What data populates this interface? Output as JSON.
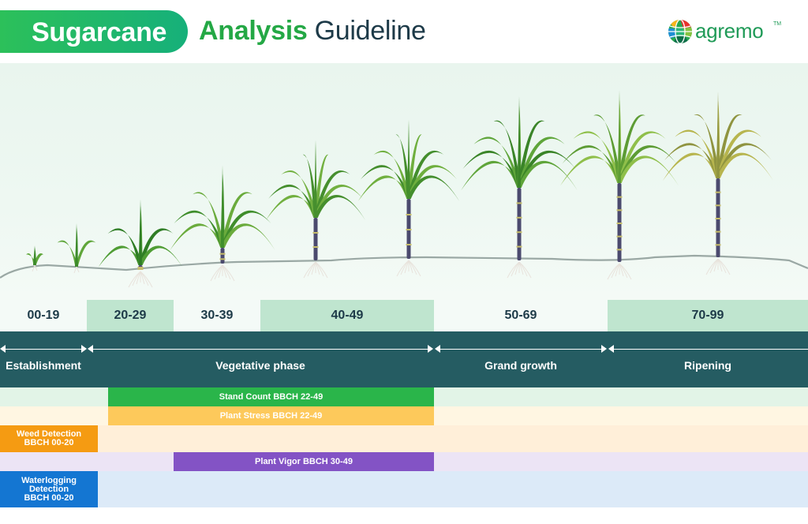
{
  "header": {
    "title_pill": "Sugarcane",
    "title_bold": "Analysis",
    "title_rest": "Guideline"
  },
  "logo": {
    "text": "agremo",
    "tm": "TM",
    "icon": "globe-icon"
  },
  "scene": {
    "description_icon": "sugarcane-growth-stages-illustration"
  },
  "bbch_ranges": [
    {
      "label": "00-19",
      "bg": "#f4faf7"
    },
    {
      "label": "20-29",
      "bg": "#bfe5cf"
    },
    {
      "label": "30-39",
      "bg": "#f4faf7"
    },
    {
      "label": "40-49",
      "bg": "#bfe5cf"
    },
    {
      "label": "50-69",
      "bg": "#f4faf7"
    },
    {
      "label": "70-99",
      "bg": "#bfe5cf"
    }
  ],
  "phases": [
    {
      "label": "Establishment"
    },
    {
      "label": "Vegetative phase"
    },
    {
      "label": "Grand growth"
    },
    {
      "label": "Ripening"
    }
  ],
  "colors": {
    "phase_band": "#255c62",
    "stand_count": "#2ab54a",
    "plant_stress": "#fdc95b",
    "weed_detection": "#f59b12",
    "plant_vigor": "#8353c5",
    "waterlogging": "#1476d2"
  },
  "analyses": {
    "stand_count": "Stand Count BBCH 22-49",
    "plant_stress": "Plant Stress BBCH 22-49",
    "weed_detection": [
      "Weed Detection",
      "BBCH 00-20"
    ],
    "plant_vigor": "Plant Vigor BBCH 30-49",
    "waterlogging": [
      "Waterlogging",
      "Detection",
      "BBCH 00-20"
    ]
  }
}
